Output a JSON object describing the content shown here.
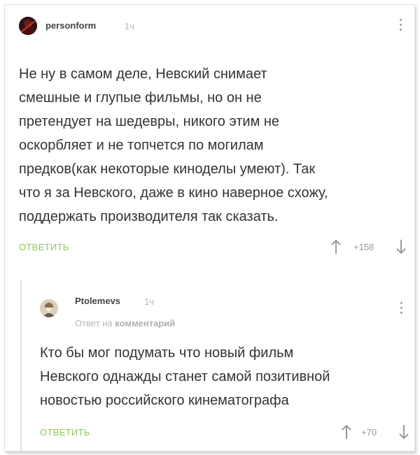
{
  "comments": [
    {
      "username": "personform",
      "time": "1ч",
      "lines": [
        "Не ну в самом деле, Невский снимает",
        "смешные и глупые фильмы, но он не",
        "претендует на шедевры, никого этим не",
        "оскорбляет и не топчется по могилам",
        "предков(как некоторые киноделы умеют). Так",
        "что я за Невского, даже в кино наверное схожу,",
        "поддержать производителя так сказать."
      ],
      "reply_label": "ОТВЕТИТЬ",
      "rating": "+158"
    },
    {
      "username": "Ptolemevs",
      "time": "1ч",
      "reply_prefix": "Ответ на",
      "reply_link": "комментарий",
      "lines": [
        "Кто бы мог подумать что новый фильм",
        "Невского однажды станет самой позитивной",
        "новостью российского кинематографа"
      ],
      "reply_label": "ОТВЕТИТЬ",
      "rating": "+70"
    }
  ],
  "colors": {
    "reply_green": "#8ac858",
    "muted": "#b5b5b5"
  },
  "icons": [
    "avatar",
    "more-icon",
    "arrow-up-icon",
    "arrow-down-icon"
  ]
}
